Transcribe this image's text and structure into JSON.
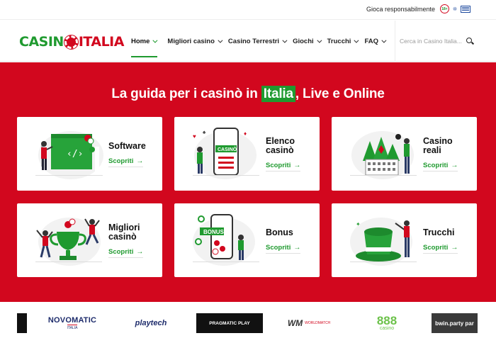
{
  "topbar": {
    "responsible_text": "Gioca responsabilmente",
    "badge_18": "18+"
  },
  "header": {
    "logo": {
      "left": "CASIN",
      "right": "ITALIA"
    },
    "nav": [
      {
        "label": "Home",
        "active": true
      },
      {
        "label": "Migliori casino",
        "active": false
      },
      {
        "label": "Casino Terrestri",
        "active": false
      },
      {
        "label": "Giochi",
        "active": false
      },
      {
        "label": "Trucchi",
        "active": false
      },
      {
        "label": "FAQ",
        "active": false
      }
    ],
    "search": {
      "placeholder": "Cerca in Casino Italia...",
      "icon": "search-icon"
    }
  },
  "hero": {
    "title_before": "La guida per i casinò in ",
    "title_highlight": "Italia",
    "title_after": ", Live e Online",
    "cards": [
      {
        "title": "Software",
        "cta": "Scopriti",
        "icon": "software-illustration"
      },
      {
        "title": "Elenco casinò",
        "cta": "Scopriti",
        "icon": "casino-list-illustration"
      },
      {
        "title": "Casino reali",
        "cta": "Scopriti",
        "icon": "real-casino-illustration"
      },
      {
        "title": "Migliori casinò",
        "cta": "Scopriti",
        "icon": "trophy-illustration"
      },
      {
        "title": "Bonus",
        "cta": "Scopriti",
        "icon": "bonus-illustration"
      },
      {
        "title": "Trucchi",
        "cta": "Scopriti",
        "icon": "magic-hat-illustration"
      }
    ]
  },
  "partners": [
    {
      "name": "NOVOMATIC",
      "sub": "ITALIA"
    },
    {
      "name": "playtech",
      "sub": ""
    },
    {
      "name": "PRAGMATIC PLAY",
      "sub": ""
    },
    {
      "name": "WM",
      "sub": "WORLDMATCH"
    },
    {
      "name": "888",
      "sub": "casino"
    },
    {
      "name": "bwin.party par",
      "sub": ""
    }
  ],
  "colors": {
    "brand_red": "#d2071e",
    "brand_green": "#1f9a2f"
  }
}
